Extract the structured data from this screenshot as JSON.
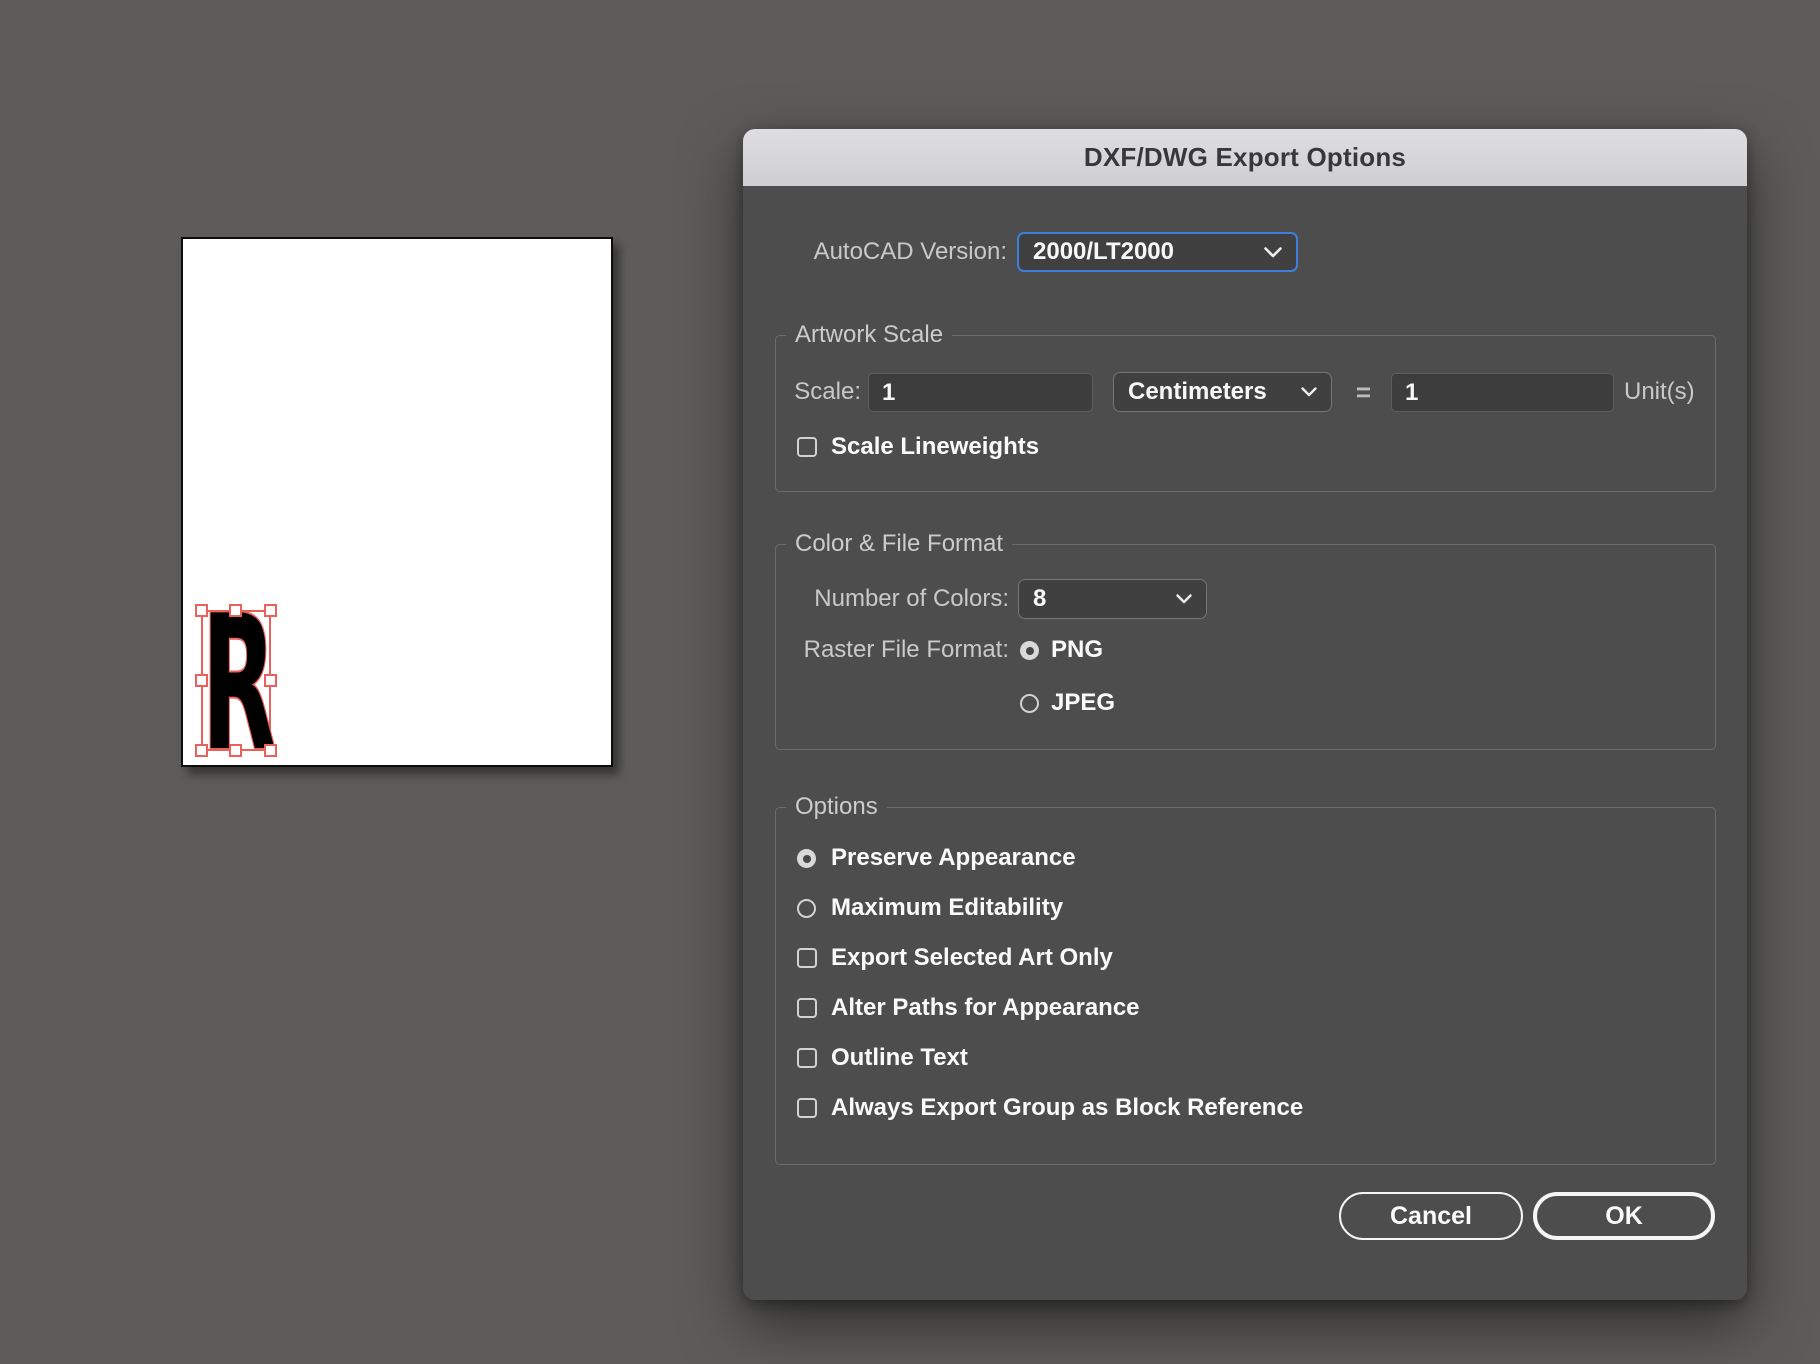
{
  "window": {
    "title": "DXF/DWG Export Options"
  },
  "artboard": {
    "letter": "R"
  },
  "autocad": {
    "label": "AutoCAD Version:",
    "value": "2000/LT2000"
  },
  "artwork_scale": {
    "title": "Artwork Scale",
    "scale_label": "Scale:",
    "scale_value": "1",
    "unit_selector": "Centimeters",
    "equals": "=",
    "unit_value": "1",
    "units_suffix": "Unit(s)",
    "scale_lineweights": {
      "label": "Scale Lineweights",
      "checked": false
    }
  },
  "color_file_format": {
    "title": "Color & File Format",
    "colors_label": "Number of Colors:",
    "colors_value": "8",
    "raster_label": "Raster File Format:",
    "raster_options": [
      {
        "label": "PNG",
        "selected": true
      },
      {
        "label": "JPEG",
        "selected": false
      }
    ]
  },
  "options": {
    "title": "Options",
    "items": [
      {
        "type": "radio",
        "label": "Preserve Appearance",
        "selected": true
      },
      {
        "type": "radio",
        "label": "Maximum Editability",
        "selected": false
      },
      {
        "type": "checkbox",
        "label": "Export Selected Art Only",
        "checked": false
      },
      {
        "type": "checkbox",
        "label": "Alter Paths for Appearance",
        "checked": false
      },
      {
        "type": "checkbox",
        "label": "Outline Text",
        "checked": false
      },
      {
        "type": "checkbox",
        "label": "Always Export Group as Block Reference",
        "checked": false
      }
    ]
  },
  "buttons": {
    "cancel": "Cancel",
    "ok": "OK"
  },
  "icons": {
    "dropdown": "chevron-down"
  },
  "colors": {
    "page_bg": "#5d5c5a",
    "dialog_bg": "#4d4d4d",
    "titlebar_bg": "#d6d6d8",
    "input_bg": "#3d3d3d",
    "focus_blue": "#3e7fdd",
    "selection_red": "#e8615c",
    "label_gray": "#c9c9c9",
    "text_white": "#fafafa"
  }
}
